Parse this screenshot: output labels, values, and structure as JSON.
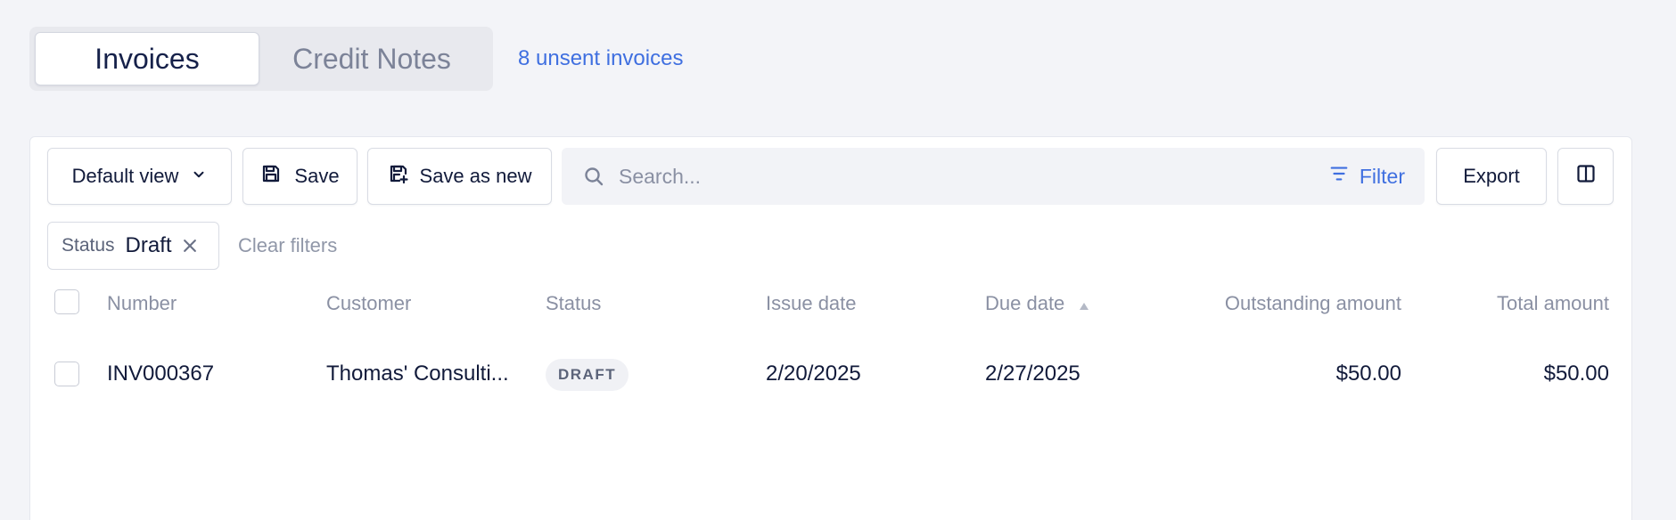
{
  "tabs": [
    {
      "label": "Invoices",
      "active": true
    },
    {
      "label": "Credit Notes",
      "active": false
    }
  ],
  "unsent_link": "8 unsent invoices",
  "toolbar": {
    "default_view_label": "Default view",
    "save_label": "Save",
    "save_as_new_label": "Save as new",
    "search_placeholder": "Search...",
    "filter_label": "Filter",
    "export_label": "Export"
  },
  "active_filters": [
    {
      "field": "Status",
      "value": "Draft"
    }
  ],
  "clear_filters_label": "Clear filters",
  "table": {
    "columns": [
      "Number",
      "Customer",
      "Status",
      "Issue date",
      "Due date",
      "Outstanding amount",
      "Total amount"
    ],
    "sort_column": "Due date",
    "rows": [
      {
        "number": "INV000367",
        "customer": "Thomas' Consulti...",
        "status": "DRAFT",
        "issue_date": "2/20/2025",
        "due_date": "2/27/2025",
        "outstanding_amount": "$50.00",
        "total_amount": "$50.00"
      }
    ]
  },
  "colors": {
    "accent": "#3f6fe0",
    "background": "#f3f4f8",
    "text_primary": "#111a3a",
    "text_muted": "#8a90a3"
  }
}
